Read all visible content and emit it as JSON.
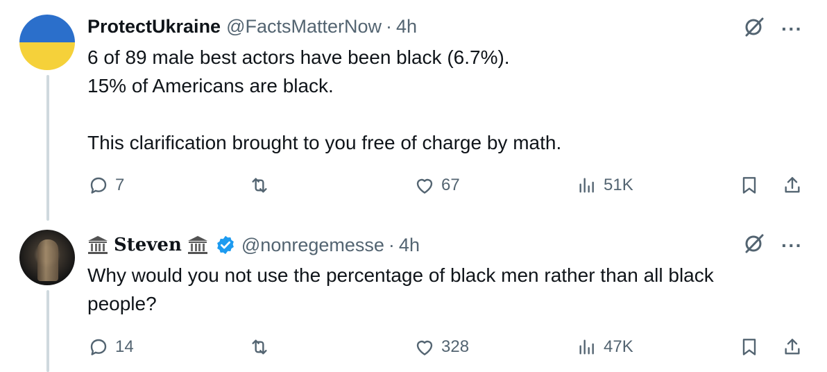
{
  "colors": {
    "text": "#0f1419",
    "muted": "#536471",
    "line": "#cfd9de",
    "verified": "#1d9bf0"
  },
  "tweets": [
    {
      "display_name": "ProtectUkraine",
      "handle": "@FactsMatterNow",
      "separator": "·",
      "time": "4h",
      "text": "6 of 89 male best actors have been black (6.7%).\n15% of Americans are black.\n\nThis clarification brought to you free of charge by math.",
      "replies": "7",
      "retweets": "",
      "likes": "67",
      "views": "51K",
      "more_label": "···"
    },
    {
      "display_name": "Steven",
      "handle": "@nonregemesse",
      "separator": "·",
      "time": "4h",
      "text": "Why would you not use the percentage of black men rather than all black people?",
      "replies": "14",
      "retweets": "",
      "likes": "328",
      "views": "47K",
      "more_label": "···"
    }
  ]
}
